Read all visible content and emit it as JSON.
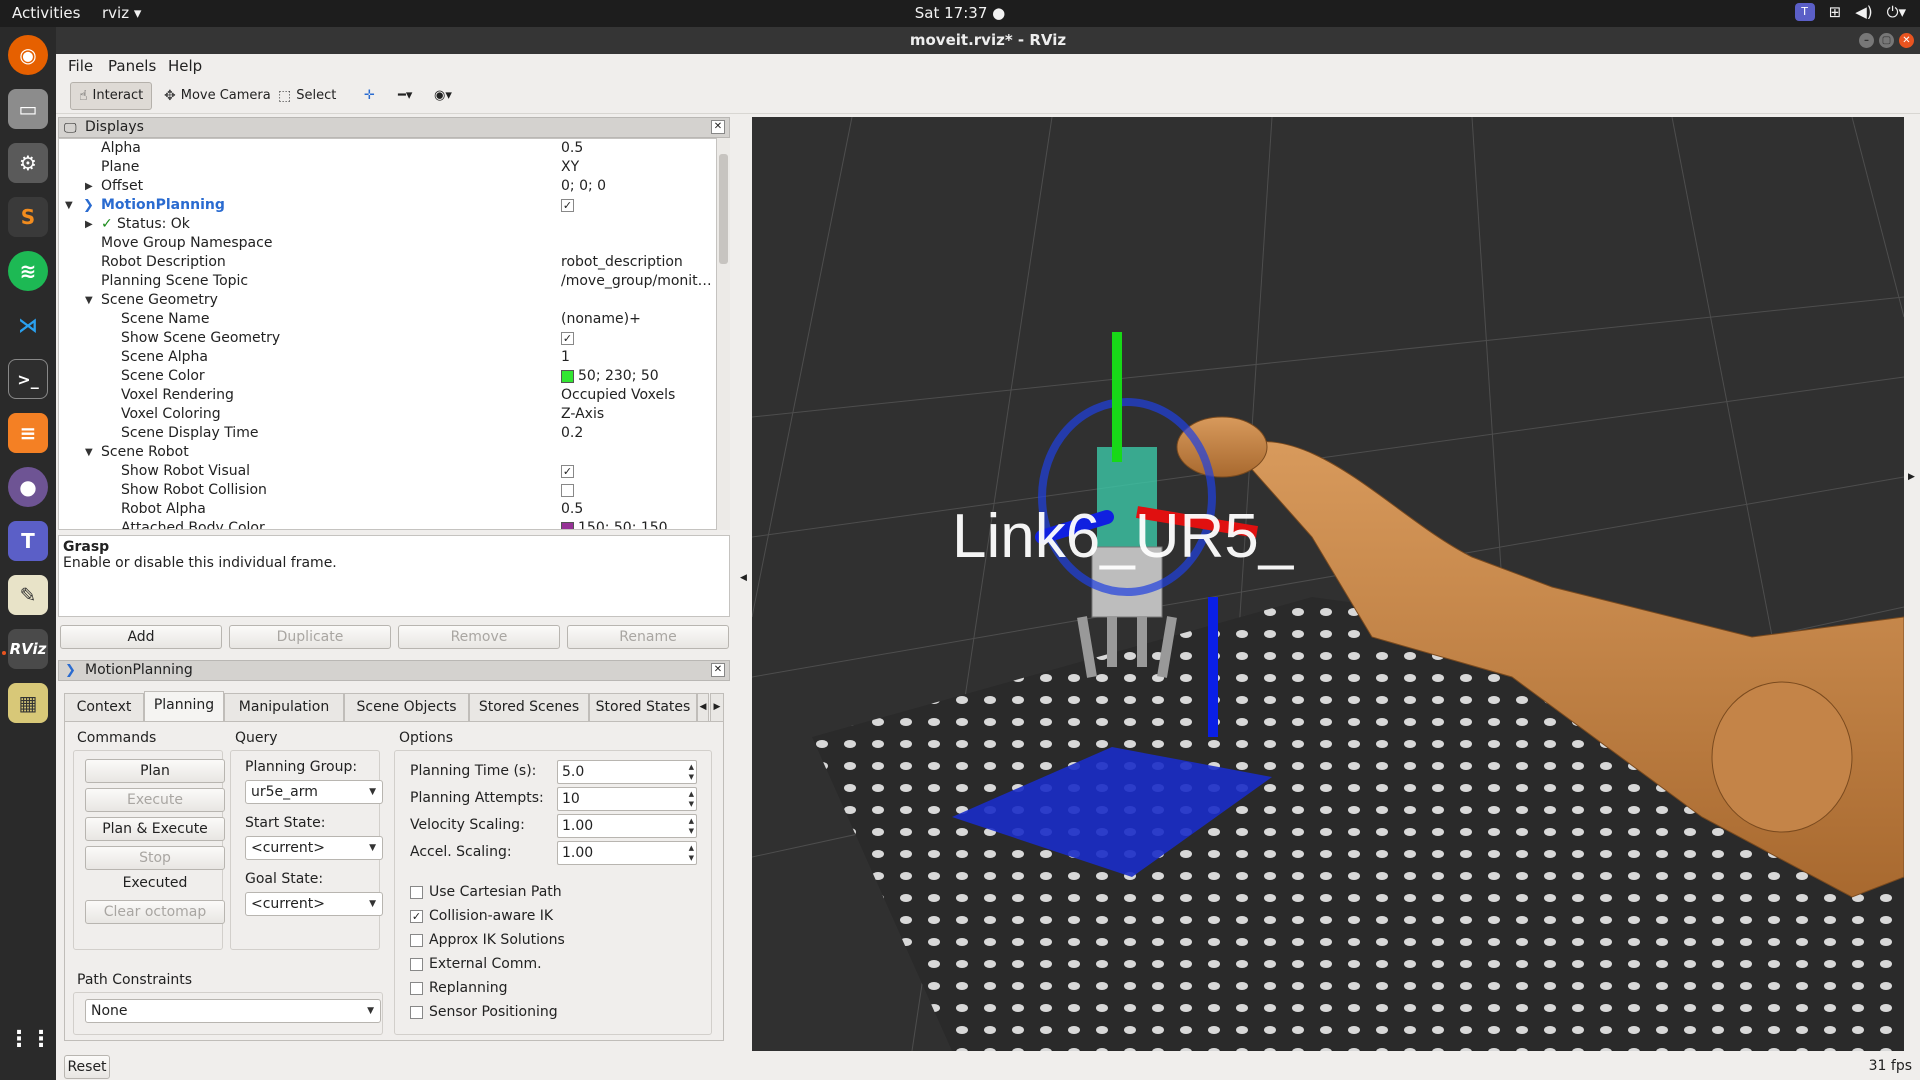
{
  "topbar": {
    "activities": "Activities",
    "app_name": "rviz ▾",
    "clock": "Sat 17:37 ●",
    "tray_icons": [
      "teams-tray-icon",
      "network-icon",
      "volume-icon",
      "power-icon"
    ]
  },
  "dock": {
    "items": [
      "firefox-icon",
      "files-icon",
      "settings-icon",
      "sublime-icon",
      "spotify-icon",
      "vscode-icon",
      "terminal-icon",
      "stack-icon",
      "github-icon",
      "teams-icon",
      "text-editor-icon",
      "rviz-icon",
      "image-viewer-icon",
      "app-grid-icon"
    ],
    "rviz_label": "RViz"
  },
  "window": {
    "title": "moveit.rviz* - RViz"
  },
  "menu": [
    "File",
    "Panels",
    "Help"
  ],
  "toolbar": {
    "interact": "Interact",
    "move_camera": "Move Camera",
    "select": "Select"
  },
  "displays": {
    "title": "Displays",
    "rows": [
      {
        "key": "Alpha",
        "value": "0.5"
      },
      {
        "key": "Plane",
        "value": "XY"
      },
      {
        "key": "Offset",
        "value": "0; 0; 0"
      },
      {
        "key": "MotionPlanning",
        "value": ""
      },
      {
        "key": "Status: Ok",
        "value": ""
      },
      {
        "key": "Move Group Namespace",
        "value": ""
      },
      {
        "key": "Robot Description",
        "value": "robot_description"
      },
      {
        "key": "Planning Scene Topic",
        "value": "/move_group/monit…"
      },
      {
        "key": "Scene Geometry",
        "value": ""
      },
      {
        "key": "Scene Name",
        "value": "(noname)+"
      },
      {
        "key": "Show Scene Geometry",
        "value": ""
      },
      {
        "key": "Scene Alpha",
        "value": "1"
      },
      {
        "key": "Scene Color",
        "value": "50; 230; 50"
      },
      {
        "key": "Voxel Rendering",
        "value": "Occupied Voxels"
      },
      {
        "key": "Voxel Coloring",
        "value": "Z-Axis"
      },
      {
        "key": "Scene Display Time",
        "value": "0.2"
      },
      {
        "key": "Scene Robot",
        "value": ""
      },
      {
        "key": "Show Robot Visual",
        "value": ""
      },
      {
        "key": "Show Robot Collision",
        "value": ""
      },
      {
        "key": "Robot Alpha",
        "value": "0.5"
      },
      {
        "key": "Attached Body Color",
        "value": "150; 50; 150"
      }
    ],
    "scene_color": "#32e632",
    "attached_color": "#963296"
  },
  "description": {
    "title": "Grasp",
    "text": "Enable or disable this individual frame."
  },
  "display_buttons": [
    "Add",
    "Duplicate",
    "Remove",
    "Rename"
  ],
  "motion_planning": {
    "title": "MotionPlanning",
    "tabs": [
      "Context",
      "Planning",
      "Manipulation",
      "Scene Objects",
      "Stored Scenes",
      "Stored States"
    ],
    "commands_title": "Commands",
    "commands": [
      "Plan",
      "Execute",
      "Plan & Execute",
      "Stop"
    ],
    "status": "Executed",
    "clear_octomap": "Clear octomap",
    "query_title": "Query",
    "planning_group_label": "Planning Group:",
    "planning_group": "ur5e_arm",
    "start_state_label": "Start State:",
    "start_state": "<current>",
    "goal_state_label": "Goal State:",
    "goal_state": "<current>",
    "options_title": "Options",
    "planning_time_label": "Planning Time (s):",
    "planning_time": "5.0",
    "planning_attempts_label": "Planning Attempts:",
    "planning_attempts": "10",
    "velocity_scaling_label": "Velocity Scaling:",
    "velocity_scaling": "1.00",
    "accel_scaling_label": "Accel. Scaling:",
    "accel_scaling": "1.00",
    "checkboxes": [
      {
        "label": "Use Cartesian Path",
        "checked": false
      },
      {
        "label": "Collision-aware IK",
        "checked": true
      },
      {
        "label": "Approx IK Solutions",
        "checked": false
      },
      {
        "label": "External Comm.",
        "checked": false
      },
      {
        "label": "Replanning",
        "checked": false
      },
      {
        "label": "Sensor Positioning",
        "checked": false
      }
    ],
    "path_constraints_title": "Path Constraints",
    "path_constraints": "None"
  },
  "bottom": {
    "reset": "Reset",
    "fps": "31 fps"
  },
  "viewport": {
    "overlay_text": "Link6_UR5_"
  }
}
